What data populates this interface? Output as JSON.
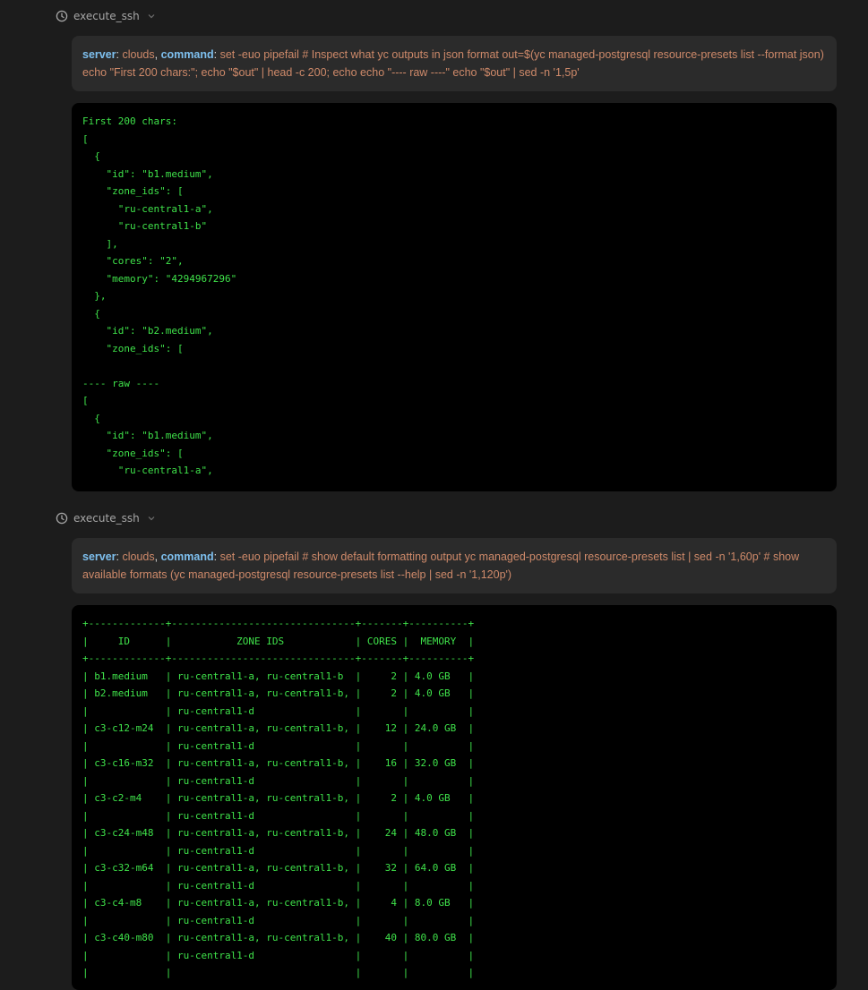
{
  "blocks": [
    {
      "tool_name": "execute_ssh",
      "server_label": "server",
      "server_value": "clouds",
      "command_label": "command",
      "command_value": "set -euo pipefail # Inspect what yc outputs in json format out=$(yc managed-postgresql resource-presets list --format json) echo \"First 200 chars:\"; echo \"$out\" | head -c 200; echo echo \"---- raw ----\" echo \"$out\" | sed -n '1,5p'",
      "output_lines": [
        "First 200 chars:",
        "[",
        "  {",
        "    \"id\": \"b1.medium\",",
        "    \"zone_ids\": [",
        "      \"ru-central1-a\",",
        "      \"ru-central1-b\"",
        "    ],",
        "    \"cores\": \"2\",",
        "    \"memory\": \"4294967296\"",
        "  },",
        "  {",
        "    \"id\": \"b2.medium\",",
        "    \"zone_ids\": [",
        "",
        "---- raw ----",
        "[",
        "  {",
        "    \"id\": \"b1.medium\",",
        "    \"zone_ids\": [",
        "      \"ru-central1-a\","
      ]
    },
    {
      "tool_name": "execute_ssh",
      "server_label": "server",
      "server_value": "clouds",
      "command_label": "command",
      "command_value": "set -euo pipefail # show default formatting output yc managed-postgresql resource-presets list | sed -n '1,60p' # show available formats (yc managed-postgresql resource-presets list --help | sed -n '1,120p')",
      "output_lines": [
        "+-------------+-------------------------------+-------+----------+",
        "|     ID      |           ZONE IDS            | CORES |  MEMORY  |",
        "+-------------+-------------------------------+-------+----------+",
        "| b1.medium   | ru-central1-a, ru-central1-b  |     2 | 4.0 GB   |",
        "| b2.medium   | ru-central1-a, ru-central1-b, |     2 | 4.0 GB   |",
        "|             | ru-central1-d                 |       |          |",
        "| c3-c12-m24  | ru-central1-a, ru-central1-b, |    12 | 24.0 GB  |",
        "|             | ru-central1-d                 |       |          |",
        "| c3-c16-m32  | ru-central1-a, ru-central1-b, |    16 | 32.0 GB  |",
        "|             | ru-central1-d                 |       |          |",
        "| c3-c2-m4    | ru-central1-a, ru-central1-b, |     2 | 4.0 GB   |",
        "|             | ru-central1-d                 |       |          |",
        "| c3-c24-m48  | ru-central1-a, ru-central1-b, |    24 | 48.0 GB  |",
        "|             | ru-central1-d                 |       |          |",
        "| c3-c32-m64  | ru-central1-a, ru-central1-b, |    32 | 64.0 GB  |",
        "|             | ru-central1-d                 |       |          |",
        "| c3-c4-m8    | ru-central1-a, ru-central1-b, |     4 | 8.0 GB   |",
        "|             | ru-central1-d                 |       |          |",
        "| c3-c40-m80  | ru-central1-a, ru-central1-b, |    40 | 80.0 GB  |",
        "|             | ru-central1-d                 |       |          |",
        "|             |                               |       |          |"
      ]
    }
  ]
}
